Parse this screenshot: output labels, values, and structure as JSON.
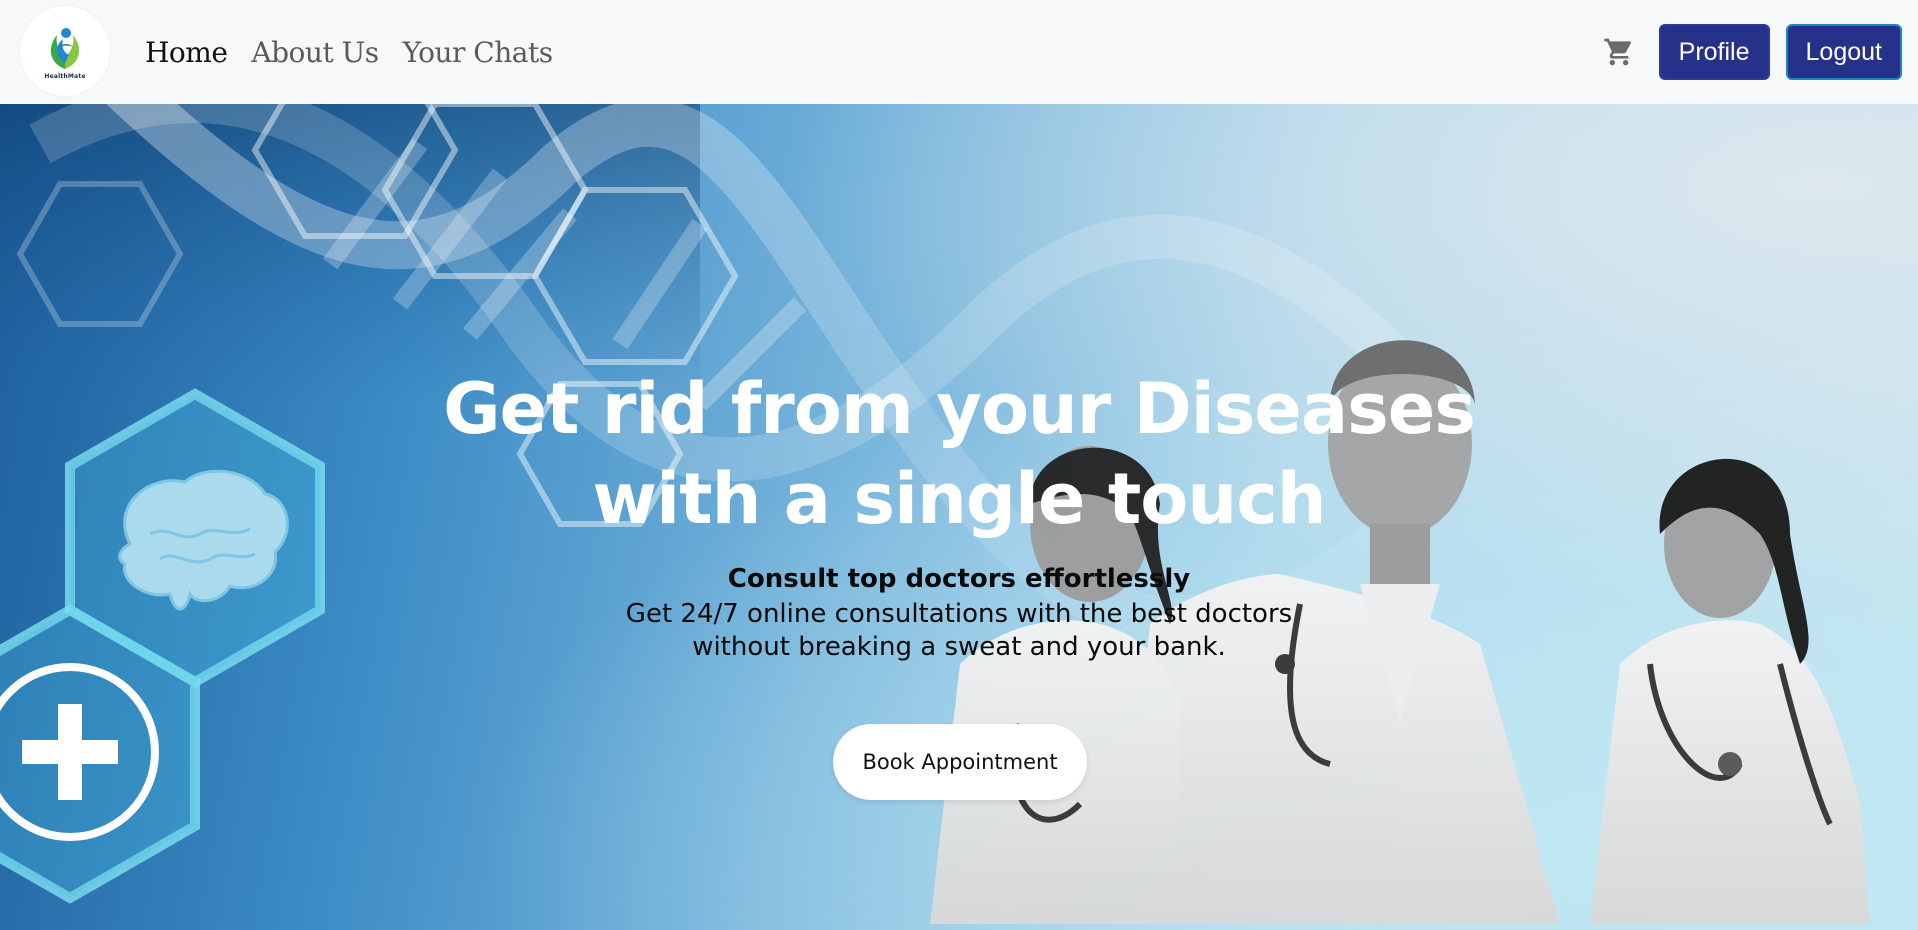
{
  "brand": {
    "logo_text": "HealthMate"
  },
  "nav": {
    "links": [
      {
        "label": "Home"
      },
      {
        "label": "About Us"
      },
      {
        "label": "Your Chats"
      }
    ],
    "cart_icon": "shopping-cart-icon",
    "profile_label": "Profile",
    "logout_label": "Logout"
  },
  "hero": {
    "headline": "Get rid from your Diseases with a single touch",
    "subtitle": "Consult top doctors effortlessly",
    "description": "Get 24/7 online consultations with the best doctors without breaking a sweat and your bank.",
    "cta_label": "Book Appointment"
  },
  "colors": {
    "nav_bg": "#f7f8fa",
    "button_bg": "#26318a",
    "hero_blue": "#3c8cc6"
  }
}
